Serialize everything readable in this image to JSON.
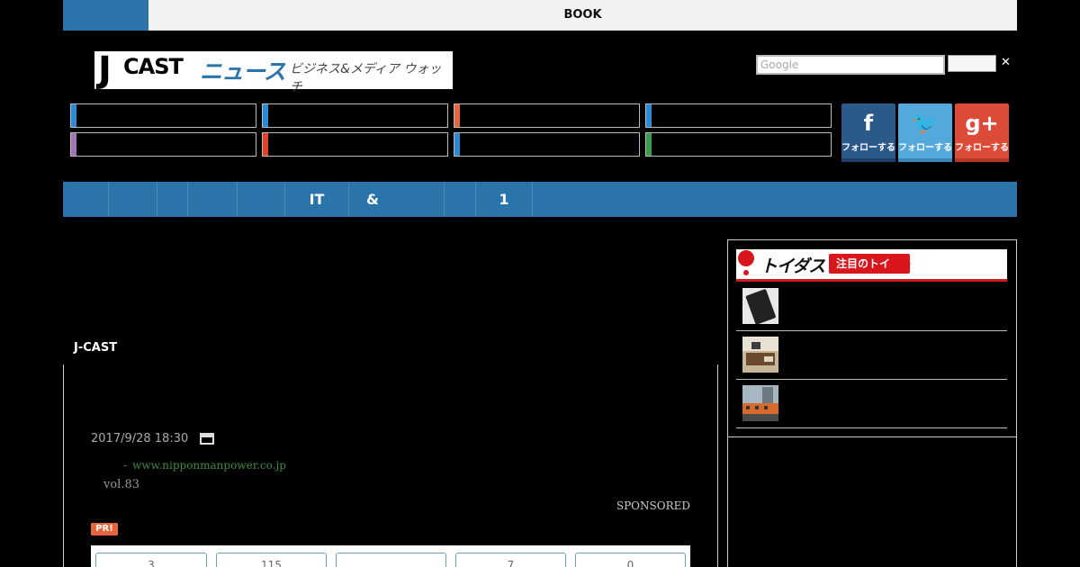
{
  "topbar": {
    "title": "BOOK"
  },
  "logo": {
    "j": "J",
    "cast": "CAST",
    "news": "ニュース",
    "tagline": "ビジネス&メディア ウォッチ"
  },
  "search": {
    "placeholder": "Google",
    "close": "✕"
  },
  "categories": [
    {
      "color": "#2a8ad4"
    },
    {
      "color": "#2a8ad4"
    },
    {
      "color": "#e8643b"
    },
    {
      "color": "#2a8ad4"
    },
    {
      "color": "#a275b6"
    },
    {
      "color": "#e0432c"
    },
    {
      "color": "#2a8ad4"
    },
    {
      "color": "#3b9a49"
    }
  ],
  "social": [
    {
      "icon": "facebook-icon",
      "glyph": "f",
      "label": "フォローする",
      "color": "#2b5a8a",
      "shadow": "#1e4068"
    },
    {
      "icon": "twitter-icon",
      "glyph": "🐦",
      "label": "フォローする",
      "color": "#55a8dc",
      "shadow": "#3b86b6"
    },
    {
      "icon": "google-plus-icon",
      "glyph": "g+",
      "label": "フォローする",
      "color": "#dc4a38",
      "shadow": "#b3382a"
    }
  ],
  "nav": [
    "",
    "",
    "",
    "",
    "",
    "IT",
    "&",
    "",
    "1",
    ""
  ],
  "article": {
    "section": "J-CAST",
    "date": "2017/9/28 18:30",
    "sponsor_dash": "-",
    "sponsor_url": "www.nipponmanpower.co.jp",
    "vol": "vol.83",
    "sponsored": "SPONSORED",
    "pr": "PR!",
    "stats": [
      "3",
      "115",
      "",
      "7",
      "0"
    ]
  },
  "sidebar": {
    "brand": "トイダス",
    "attention": "注目のトイ"
  }
}
